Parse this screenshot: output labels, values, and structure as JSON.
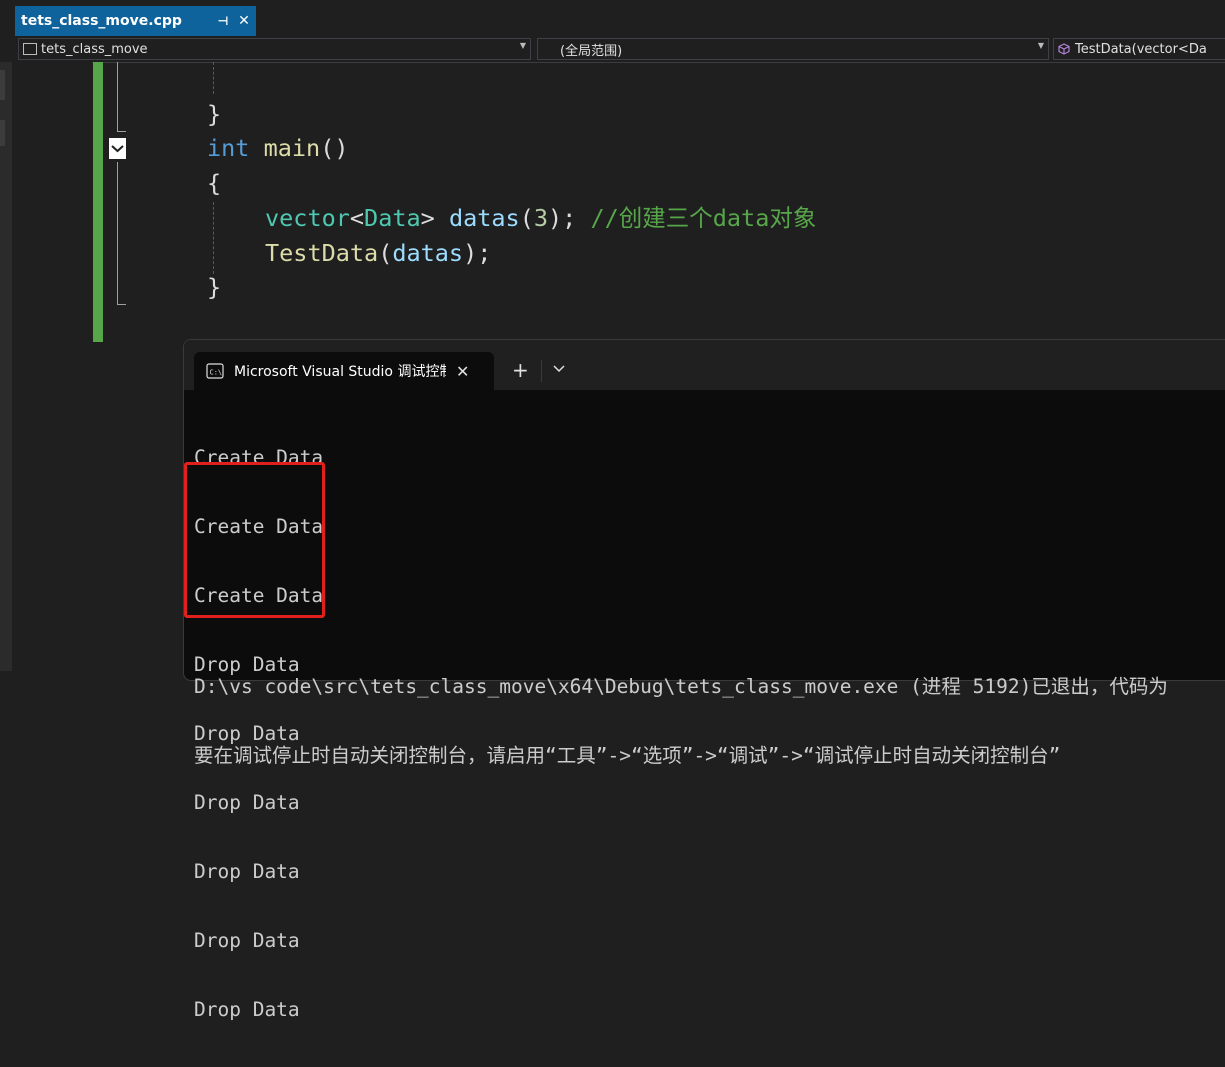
{
  "editor": {
    "tab": {
      "filename": "tets_class_move.cpp",
      "pin_glyph": "⊣",
      "close_glyph": "✕"
    },
    "navbar": {
      "project": "tets_class_move",
      "scope": "(全局范围)",
      "member": "TestData(vector<Da"
    },
    "code": {
      "line1": "}",
      "line2_kw": "int",
      "line2_fn": "main",
      "line2_rest": "()",
      "line3": "{",
      "line4_type": "vector",
      "line4_lt": "<",
      "line4_arg": "Data",
      "line4_gt": ">",
      "line4_var": "datas",
      "line4_open": "(",
      "line4_num": "3",
      "line4_close": ");",
      "line4_comment": "//创建三个data对象",
      "line5_fn": "TestData",
      "line5_open": "(",
      "line5_var": "datas",
      "line5_close": ");",
      "line6": "}"
    }
  },
  "console": {
    "title": "Microsoft Visual Studio 调试控制台",
    "close_glyph": "✕",
    "new_tab_glyph": "+",
    "output_lines": [
      "Create Data",
      "Create Data",
      "Create Data",
      "Drop Data",
      "Drop Data",
      "Drop Data",
      "Drop Data",
      "Drop Data",
      "Drop Data"
    ],
    "footer_line1": "D:\\vs code\\src\\tets_class_move\\x64\\Debug\\tets_class_move.exe (进程 5192)已退出，代码为",
    "footer_line2": "要在调试停止时自动关闭控制台，请启用“工具”->“选项”->“调试”->“调试停止时自动关闭控制台”"
  },
  "colors": {
    "accent": "#0e639c",
    "highlight_box": "#e0201c",
    "change_bar": "#57a64a"
  }
}
